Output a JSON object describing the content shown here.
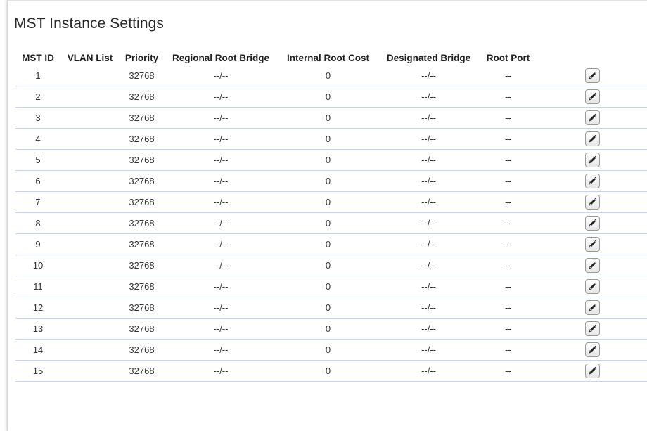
{
  "page": {
    "title": "MST Instance Settings"
  },
  "table": {
    "columns": [
      "MST ID",
      "VLAN List",
      "Priority",
      "Regional Root Bridge",
      "Internal Root Cost",
      "Designated Bridge",
      "Root Port"
    ],
    "edit_icon": "pencil-icon",
    "rows": [
      {
        "mst_id": "1",
        "vlan_list": "",
        "priority": "32768",
        "regional_root_bridge": "--/--",
        "internal_root_cost": "0",
        "designated_bridge": "--/--",
        "root_port": "--"
      },
      {
        "mst_id": "2",
        "vlan_list": "",
        "priority": "32768",
        "regional_root_bridge": "--/--",
        "internal_root_cost": "0",
        "designated_bridge": "--/--",
        "root_port": "--"
      },
      {
        "mst_id": "3",
        "vlan_list": "",
        "priority": "32768",
        "regional_root_bridge": "--/--",
        "internal_root_cost": "0",
        "designated_bridge": "--/--",
        "root_port": "--"
      },
      {
        "mst_id": "4",
        "vlan_list": "",
        "priority": "32768",
        "regional_root_bridge": "--/--",
        "internal_root_cost": "0",
        "designated_bridge": "--/--",
        "root_port": "--"
      },
      {
        "mst_id": "5",
        "vlan_list": "",
        "priority": "32768",
        "regional_root_bridge": "--/--",
        "internal_root_cost": "0",
        "designated_bridge": "--/--",
        "root_port": "--"
      },
      {
        "mst_id": "6",
        "vlan_list": "",
        "priority": "32768",
        "regional_root_bridge": "--/--",
        "internal_root_cost": "0",
        "designated_bridge": "--/--",
        "root_port": "--"
      },
      {
        "mst_id": "7",
        "vlan_list": "",
        "priority": "32768",
        "regional_root_bridge": "--/--",
        "internal_root_cost": "0",
        "designated_bridge": "--/--",
        "root_port": "--"
      },
      {
        "mst_id": "8",
        "vlan_list": "",
        "priority": "32768",
        "regional_root_bridge": "--/--",
        "internal_root_cost": "0",
        "designated_bridge": "--/--",
        "root_port": "--"
      },
      {
        "mst_id": "9",
        "vlan_list": "",
        "priority": "32768",
        "regional_root_bridge": "--/--",
        "internal_root_cost": "0",
        "designated_bridge": "--/--",
        "root_port": "--"
      },
      {
        "mst_id": "10",
        "vlan_list": "",
        "priority": "32768",
        "regional_root_bridge": "--/--",
        "internal_root_cost": "0",
        "designated_bridge": "--/--",
        "root_port": "--"
      },
      {
        "mst_id": "11",
        "vlan_list": "",
        "priority": "32768",
        "regional_root_bridge": "--/--",
        "internal_root_cost": "0",
        "designated_bridge": "--/--",
        "root_port": "--"
      },
      {
        "mst_id": "12",
        "vlan_list": "",
        "priority": "32768",
        "regional_root_bridge": "--/--",
        "internal_root_cost": "0",
        "designated_bridge": "--/--",
        "root_port": "--"
      },
      {
        "mst_id": "13",
        "vlan_list": "",
        "priority": "32768",
        "regional_root_bridge": "--/--",
        "internal_root_cost": "0",
        "designated_bridge": "--/--",
        "root_port": "--"
      },
      {
        "mst_id": "14",
        "vlan_list": "",
        "priority": "32768",
        "regional_root_bridge": "--/--",
        "internal_root_cost": "0",
        "designated_bridge": "--/--",
        "root_port": "--"
      },
      {
        "mst_id": "15",
        "vlan_list": "",
        "priority": "32768",
        "regional_root_bridge": "--/--",
        "internal_root_cost": "0",
        "designated_bridge": "--/--",
        "root_port": "--"
      }
    ]
  }
}
